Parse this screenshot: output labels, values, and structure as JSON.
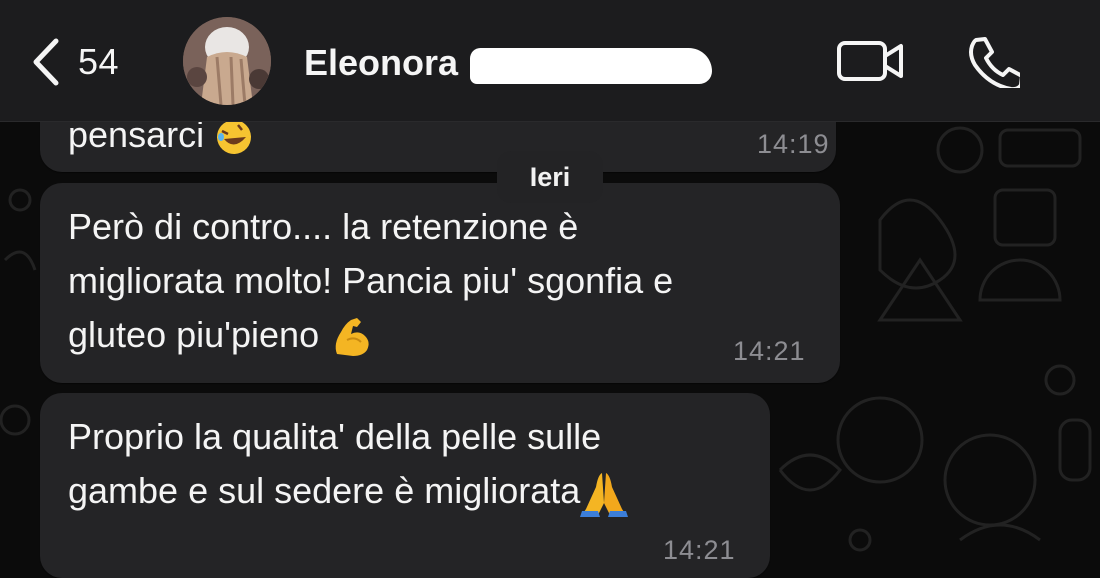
{
  "header": {
    "back_count": "54",
    "contact_name": "Eleonora"
  },
  "icons": {
    "back": "chevron-left-icon",
    "video": "video-camera-icon",
    "phone": "phone-icon"
  },
  "date_separator": "Ieri",
  "messages": [
    {
      "lines": [
        "pensarci"
      ],
      "emoji": "rolling-on-floor-laughing",
      "time": "14:19"
    },
    {
      "lines": [
        "Però di contro.... la retenzione è",
        "migliorata molto! Pancia piu' sgonfia e",
        "gluteo piu'pieno"
      ],
      "emoji": "flexed-biceps",
      "time": "14:21"
    },
    {
      "lines": [
        "Proprio la qualita' della pelle sulle",
        "gambe e sul sedere è migliorata"
      ],
      "emoji": "folded-hands",
      "time": "14:21"
    }
  ],
  "colors": {
    "background": "#0b0b0b",
    "header": "#1c1c1e",
    "bubble": "#242426",
    "timestamp": "#8d8d92"
  }
}
